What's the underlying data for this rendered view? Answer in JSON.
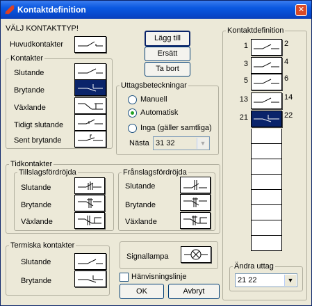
{
  "window": {
    "title": "Kontaktdefinition",
    "close": "✕"
  },
  "main": {
    "heading": "VÄLJ KONTAKTTYP!",
    "main_contact": "Huvudkontakter"
  },
  "kontakter": {
    "legend": "Kontakter",
    "items": [
      "Slutande",
      "Brytande",
      "Växlande",
      "Tidigt slutande",
      "Sent brytande"
    ],
    "selected": "Brytande"
  },
  "buttons": {
    "add": "Lägg till",
    "replace": "Ersätt",
    "remove": "Ta bort",
    "ok": "OK",
    "cancel": "Avbryt"
  },
  "uttag": {
    "legend": "Uttagsbeteckningar",
    "options": [
      "Manuell",
      "Automatisk",
      "Inga (gäller samtliga)"
    ],
    "selected": "Automatisk",
    "next_label": "Nästa",
    "next_value": "31 32"
  },
  "tidkontakter": {
    "legend": "Tidkontakter",
    "tillslag": {
      "legend": "Tillslagsfördröjda",
      "items": [
        "Slutande",
        "Brytande",
        "Växlande"
      ]
    },
    "franslag": {
      "legend": "Frånslagsfördröjda",
      "items": [
        "Slutande",
        "Brytande",
        "Växlande"
      ]
    }
  },
  "termiska": {
    "legend": "Termiska kontakter",
    "items": [
      "Slutande",
      "Brytande"
    ]
  },
  "signal": {
    "label": "Signallampa",
    "checkbox": "Hänvisningslinje",
    "checkbox_checked": false
  },
  "definition": {
    "legend": "Kontaktdefinition",
    "contacts": [
      {
        "left": "1",
        "right": "2"
      },
      {
        "left": "3",
        "right": "4"
      },
      {
        "left": "5",
        "right": "6"
      },
      {
        "left": "13",
        "right": "14"
      },
      {
        "left": "21",
        "right": "22"
      }
    ],
    "change_legend": "Ändra uttag",
    "change_value": "21 22"
  },
  "colors": {
    "selection": "#0a246a",
    "titlebar": "#0a58e0",
    "face": "#ece9d8"
  }
}
